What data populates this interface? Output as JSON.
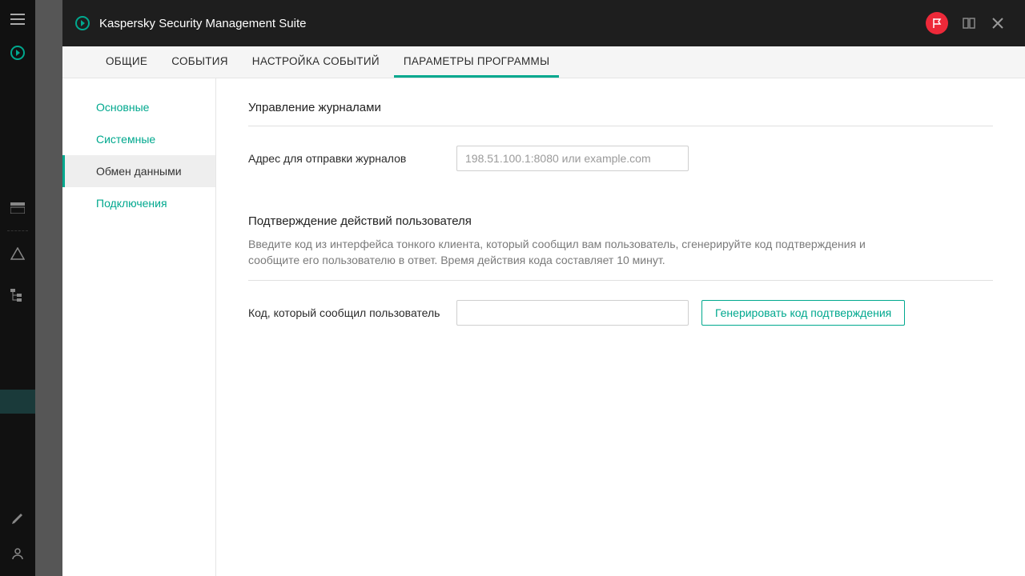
{
  "header": {
    "title": "Kaspersky Security Management Suite"
  },
  "tabs": [
    {
      "label": "ОБЩИЕ"
    },
    {
      "label": "СОБЫТИЯ"
    },
    {
      "label": "НАСТРОЙКА СОБЫТИЙ"
    },
    {
      "label": "ПАРАМЕТРЫ ПРОГРАММЫ"
    }
  ],
  "sidenav": [
    {
      "label": "Основные"
    },
    {
      "label": "Системные"
    },
    {
      "label": "Обмен данными"
    },
    {
      "label": "Подключения"
    }
  ],
  "section_logs": {
    "title": "Управление журналами",
    "address_label": "Адрес для отправки журналов",
    "address_placeholder": "198.51.100.1:8080 или example.com",
    "address_value": ""
  },
  "section_confirm": {
    "title": "Подтверждение действий пользователя",
    "help": "Введите код из интерфейса тонкого клиента, который сообщил вам пользователь, сгенерируйте код подтверждения и сообщите его пользователю в ответ. Время действия кода составляет 10 минут.",
    "code_label": "Код, который сообщил пользователь",
    "code_value": "",
    "generate_label": "Генерировать код подтверждения"
  }
}
